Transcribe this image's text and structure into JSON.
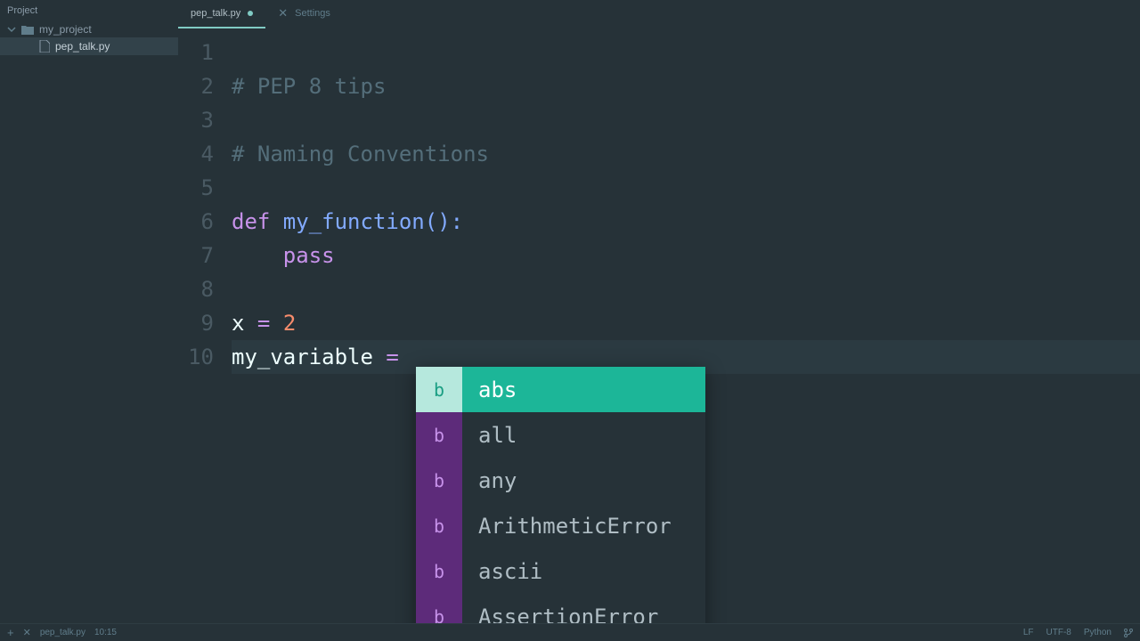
{
  "sidebar": {
    "title": "Project",
    "folder": "my_project",
    "file": "pep_talk.py"
  },
  "tabs": [
    {
      "label": "pep_talk.py",
      "active": true,
      "dirty": true
    },
    {
      "label": "Settings",
      "active": false,
      "dirty": false
    }
  ],
  "gutter": [
    "1",
    "2",
    "3",
    "4",
    "5",
    "6",
    "7",
    "8",
    "9",
    "10"
  ],
  "code": {
    "line2_comment": "# PEP 8 tips",
    "line4_comment": "# Naming Conventions",
    "line6_def": "def",
    "line6_fn": " my_function",
    "line6_paren": "():",
    "line7_pass": "pass",
    "line9_x": "x ",
    "line9_eq": "=",
    "line9_sp": " ",
    "line9_num": "2",
    "line10_var": "my_variable ",
    "line10_eq": "="
  },
  "autocomplete": {
    "icon_label": "b",
    "items": [
      {
        "label": "abs",
        "selected": true
      },
      {
        "label": "all",
        "selected": false
      },
      {
        "label": "any",
        "selected": false
      },
      {
        "label": "ArithmeticError",
        "selected": false
      },
      {
        "label": "ascii",
        "selected": false
      },
      {
        "label": "AssertionError",
        "selected": false
      }
    ]
  },
  "status": {
    "file": "pep_talk.py",
    "cursor": "10:15",
    "line_ending": "LF",
    "encoding": "UTF-8",
    "language": "Python"
  }
}
